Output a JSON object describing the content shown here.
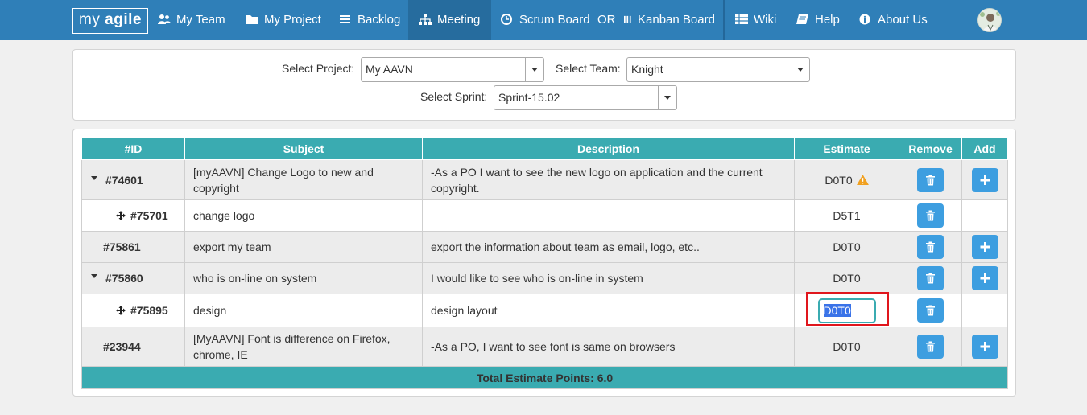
{
  "app": {
    "logo_prefix": "my ",
    "logo_bold": "agile"
  },
  "nav": {
    "my_team": "My Team",
    "my_project": "My Project",
    "backlog": "Backlog",
    "meeting": "Meeting",
    "scrum_board": "Scrum Board",
    "or_text": "OR",
    "kanban_board": "Kanban Board",
    "wiki": "Wiki",
    "help": "Help",
    "about_us": "About Us"
  },
  "filters": {
    "project_label": "Select Project:",
    "project_value": "My AAVN",
    "team_label": "Select Team:",
    "team_value": "Knight",
    "sprint_label": "Select Sprint:",
    "sprint_value": "Sprint-15.02"
  },
  "table": {
    "headers": {
      "id": "#ID",
      "subject": "Subject",
      "description": "Description",
      "estimate": "Estimate",
      "remove": "Remove",
      "add": "Add"
    },
    "rows": [
      {
        "id": "#74601",
        "subject": "[myAAVN] Change Logo to new and copyright",
        "description": "-As a PO I want to see the new logo on application and the current copyright.",
        "estimate": "D0T0"
      },
      {
        "id": "#75701",
        "subject": "change logo",
        "description": "",
        "estimate": "D5T1"
      },
      {
        "id": "#75861",
        "subject": "export my team",
        "description": "export the information about team as email, logo, etc..",
        "estimate": "D0T0"
      },
      {
        "id": "#75860",
        "subject": "who is on-line on system",
        "description": "I would like to see who is on-line in system",
        "estimate": "D0T0"
      },
      {
        "id": "#75895",
        "subject": "design",
        "description": "design layout",
        "estimate": "D0T0"
      },
      {
        "id": "#23944",
        "subject": "[MyAAVN] Font is difference on Firefox, chrome, IE",
        "description": "-As a PO, I want to see font is same on browsers",
        "estimate": "D0T0"
      }
    ],
    "total": "Total Estimate Points: 6.0"
  },
  "colors": {
    "navbar": "#2f7fb8",
    "table_header": "#3aabb1",
    "button": "#3d9ee0",
    "link": "#2f77b2",
    "highlight": "#e0161d"
  },
  "icons": [
    "users-icon",
    "folder-icon",
    "list-icon",
    "sitemap-icon",
    "clock-icon",
    "columns-icon",
    "table-icon",
    "book-icon",
    "info-icon",
    "trash-icon",
    "plus-icon",
    "warning-icon",
    "move-icon"
  ]
}
